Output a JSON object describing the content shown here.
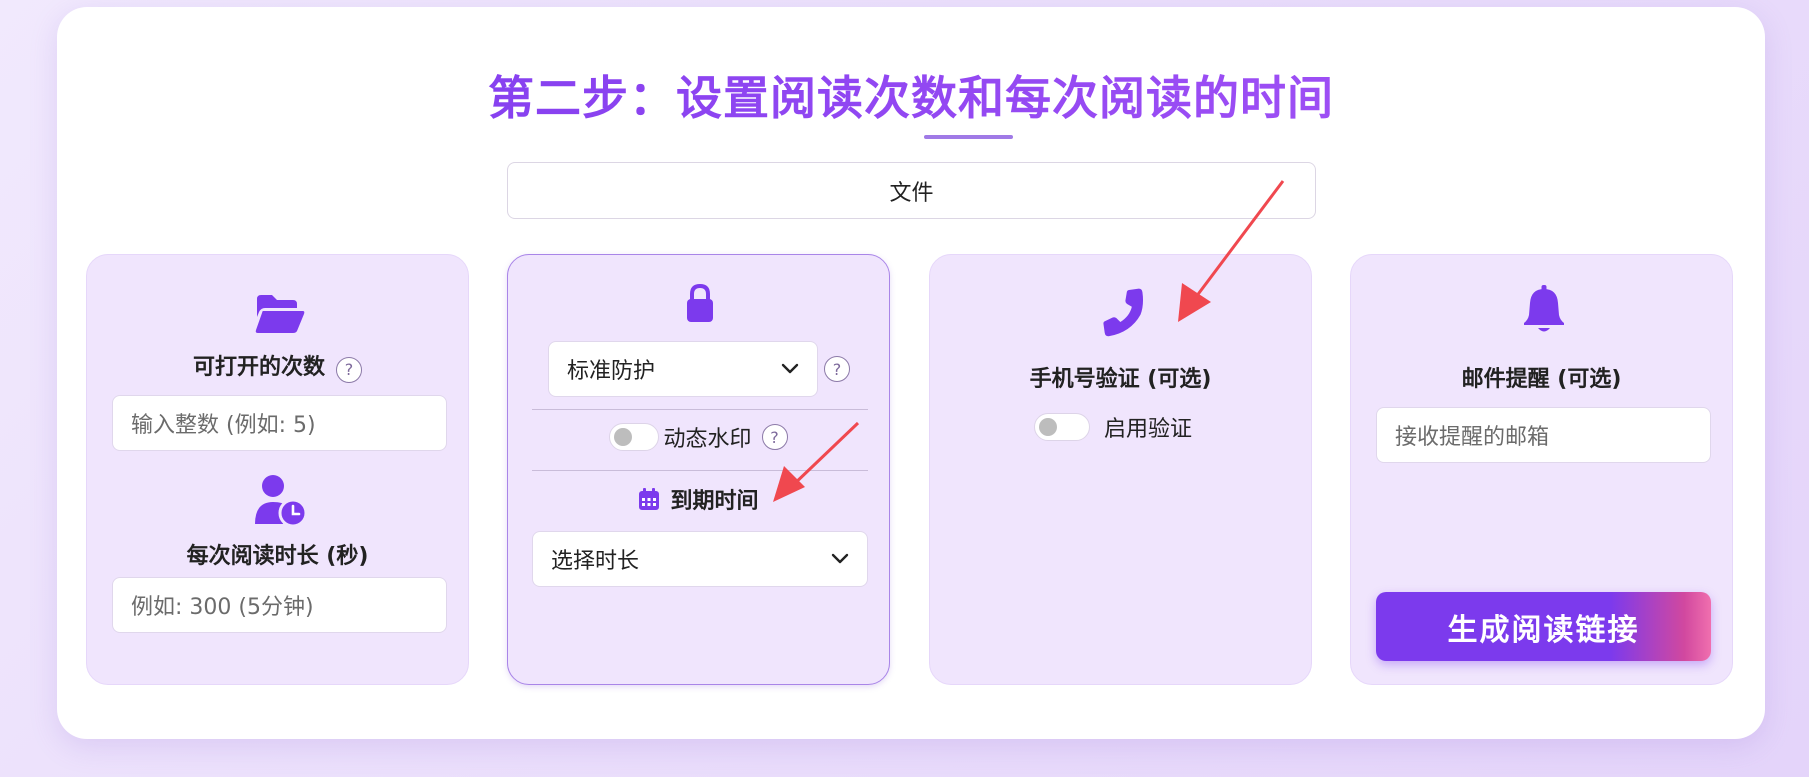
{
  "header": {
    "title": "第二步：设置阅读次数和每次阅读的时间"
  },
  "file_box": {
    "label": "文件"
  },
  "panel_open_count": {
    "icon": "folder-open-icon",
    "label": "可打开的次数",
    "help": "?",
    "input_placeholder": "输入整数 (例如: 5)",
    "duration_icon": "user-clock-icon",
    "duration_label": "每次阅读时长 (秒)",
    "duration_placeholder": "例如: 300 (5分钟)"
  },
  "panel_protection": {
    "icon": "lock-icon",
    "protection_select": "标准防护",
    "help": "?",
    "watermark_label": "动态水印",
    "watermark_enabled": false,
    "watermark_help": "?",
    "expiry_icon": "calendar-icon",
    "expiry_label": "到期时间",
    "expiry_select": "选择时长"
  },
  "panel_phone": {
    "icon": "phone-icon",
    "label": "手机号验证 (可选)",
    "toggle_label": "启用验证",
    "toggle_enabled": false
  },
  "panel_email": {
    "icon": "bell-icon",
    "label": "邮件提醒 (可选)",
    "input_placeholder": "接收提醒的邮箱",
    "generate_button": "生成阅读链接"
  },
  "colors": {
    "accent": "#7c3aed",
    "annotation_arrow": "#f0484f",
    "panel_bg": "#f0e5fd"
  }
}
